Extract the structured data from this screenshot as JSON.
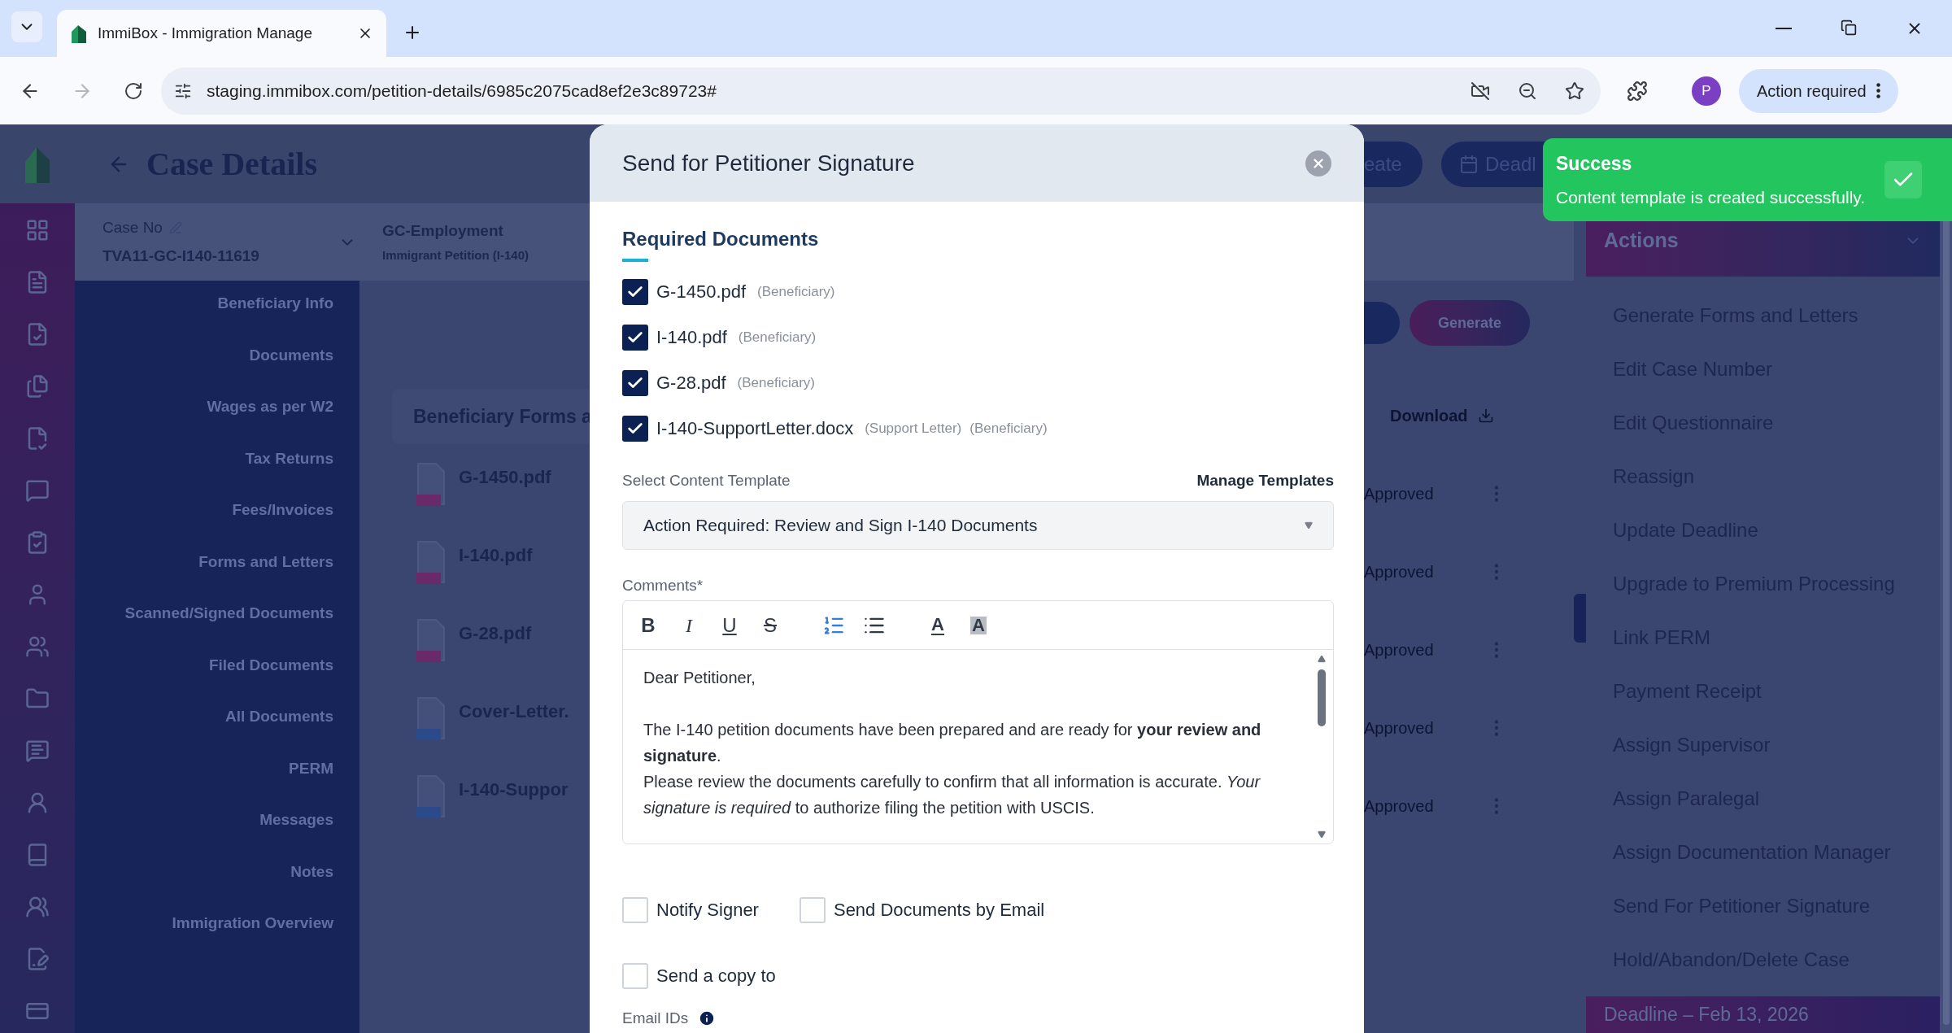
{
  "browser": {
    "tab_title": "ImmiBox - Immigration Manage",
    "url": "staging.immibox.com/petition-details/6985c2075cad8ef2e3c89723#",
    "profile_initial": "P",
    "action_button": "Action required"
  },
  "page": {
    "title": "Case Details",
    "case_no_label": "Case No",
    "case_no": "TVA11-GC-I140-11619",
    "case_type": "GC-Employment",
    "case_subtype": "Immigrant Petition (I-140)"
  },
  "header_buttons": [
    "eate",
    "Deadl"
  ],
  "sidebar": {
    "items": [
      "Beneficiary Info",
      "Documents",
      "Wages as per W2",
      "Tax Returns",
      "Fees/Invoices",
      "Forms and Letters",
      "Scanned/Signed Documents",
      "Filed Documents",
      "All Documents",
      "PERM",
      "Messages",
      "Notes",
      "Immigration Overview"
    ]
  },
  "forms_card": {
    "title": "Beneficiary Forms a",
    "files": [
      {
        "name": "G-1450.pdf",
        "kind": "pdf"
      },
      {
        "name": "I-140.pdf",
        "kind": "pdf"
      },
      {
        "name": "G-28.pdf",
        "kind": "pdf"
      },
      {
        "name": "Cover-Letter.",
        "kind": "doc"
      },
      {
        "name": "I-140-Suppor",
        "kind": "doc"
      }
    ]
  },
  "files_actions": {
    "generate": "Generate",
    "download": "Download",
    "statuses": [
      "Approved",
      "Approved",
      "Approved",
      "Approved",
      "Approved"
    ]
  },
  "actions": {
    "title": "Actions",
    "items": [
      "Generate Forms and Letters",
      "Edit Case Number",
      "Edit Questionnaire",
      "Reassign",
      "Update Deadline",
      "Upgrade to Premium Processing",
      "Link PERM",
      "Payment Receipt",
      "Assign Supervisor",
      "Assign Paralegal",
      "Assign Documentation Manager",
      "Send For Petitioner Signature",
      "Hold/Abandon/Delete Case"
    ],
    "deadline": "Deadline – Feb 13, 2026"
  },
  "toast": {
    "title": "Success",
    "message": "Content template is created successfully."
  },
  "modal": {
    "title": "Send for Petitioner Signature",
    "section_title": "Required Documents",
    "documents": [
      {
        "name": "G-1450.pdf",
        "tags": [
          "(Beneficiary)"
        ],
        "checked": true
      },
      {
        "name": "I-140.pdf",
        "tags": [
          "(Beneficiary)"
        ],
        "checked": true
      },
      {
        "name": "G-28.pdf",
        "tags": [
          "(Beneficiary)"
        ],
        "checked": true
      },
      {
        "name": "I-140-SupportLetter.docx",
        "tags": [
          "(Support Letter)",
          "(Beneficiary)"
        ],
        "checked": true
      }
    ],
    "template_label": "Select Content Template",
    "manage_link": "Manage Templates",
    "template_value": "Action Required: Review and Sign I-140 Documents",
    "comments_label": "Comments*",
    "toolbar": [
      {
        "kind": "bold",
        "label": "B",
        "active": false
      },
      {
        "kind": "italic",
        "label": "I",
        "active": false
      },
      {
        "kind": "underline",
        "label": "U",
        "active": false
      },
      {
        "kind": "strike",
        "label": "S",
        "active": false
      },
      {
        "kind": "ordered-list",
        "active": true
      },
      {
        "kind": "bullet-list",
        "active": false
      },
      {
        "kind": "font-color",
        "label": "A",
        "active": false
      },
      {
        "kind": "highlight",
        "label": "A",
        "active": false
      }
    ],
    "comment_lines": [
      "Dear Petitioner,",
      "The I-140 petition documents have been prepared and are ready for **your review and signature**.",
      "Please review the documents carefully to confirm that all information is accurate. *Your signature is required* to authorize filing the petition with USCIS."
    ],
    "options": [
      {
        "label": "Notify Signer",
        "checked": false
      },
      {
        "label": "Send Documents by Email",
        "checked": false
      }
    ],
    "copy": {
      "label": "Send a copy to",
      "checked": false
    },
    "email_label": "Email IDs"
  }
}
